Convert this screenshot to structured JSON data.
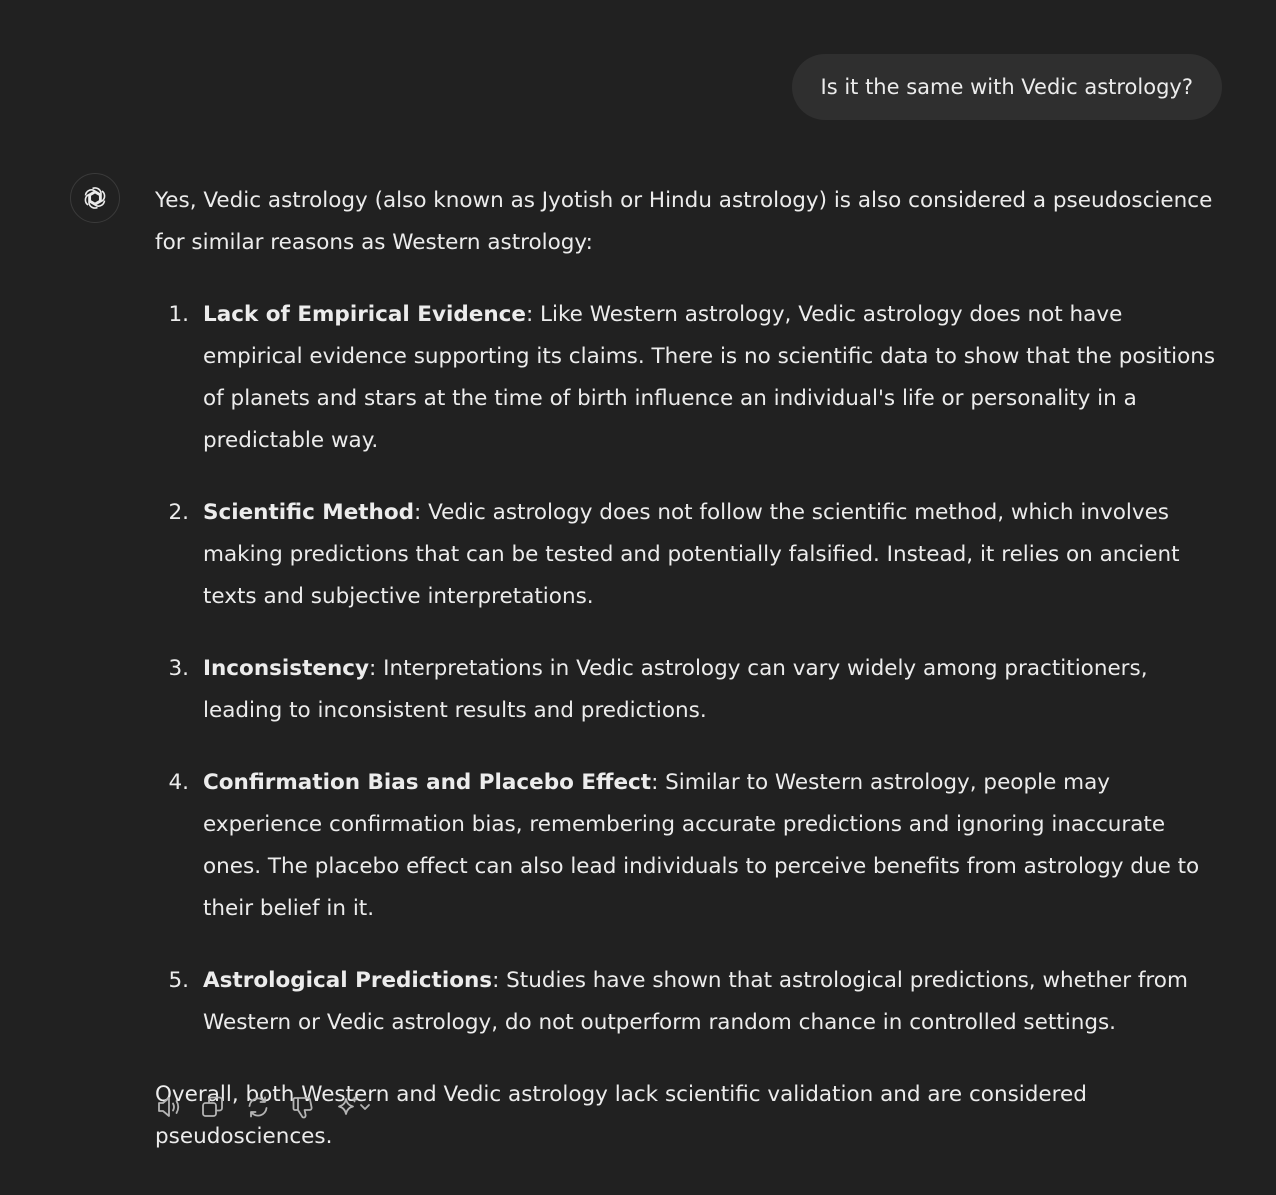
{
  "user_message": "Is it the same with Vedic astrology?",
  "assistant": {
    "avatar_icon": "openai-logo-icon",
    "intro": "Yes, Vedic astrology (also known as Jyotish or Hindu astrology) is also considered a pseudoscience for similar reasons as Western astrology:",
    "items": [
      {
        "number": "1.",
        "title": "Lack of Empirical Evidence",
        "text": ": Like Western astrology, Vedic astrology does not have empirical evidence supporting its claims. There is no scientific data to show that the positions of planets and stars at the time of birth influence an individual's life or personality in a predictable way."
      },
      {
        "number": "2.",
        "title": "Scientific Method",
        "text": ": Vedic astrology does not follow the scientific method, which involves making predictions that can be tested and potentially falsified. Instead, it relies on ancient texts and subjective interpretations."
      },
      {
        "number": "3.",
        "title": "Inconsistency",
        "text": ": Interpretations in Vedic astrology can vary widely among practitioners, leading to inconsistent results and predictions."
      },
      {
        "number": "4.",
        "title": "Confirmation Bias and Placebo Effect",
        "text": ": Similar to Western astrology, people may experience confirmation bias, remembering accurate predictions and ignoring inaccurate ones. The placebo effect can also lead individuals to perceive benefits from astrology due to their belief in it."
      },
      {
        "number": "5.",
        "title": "Astrological Predictions",
        "text": ": Studies have shown that astrological predictions, whether from Western or Vedic astrology, do not outperform random chance in controlled settings."
      }
    ],
    "conclusion": "Overall, both Western and Vedic astrology lack scientific validation and are considered pseudosciences."
  },
  "actions": [
    {
      "icon": "speaker-icon"
    },
    {
      "icon": "copy-icon"
    },
    {
      "icon": "regenerate-icon"
    },
    {
      "icon": "thumbs-down-icon"
    },
    {
      "icon": "sparkle-model-icon"
    }
  ],
  "colors": {
    "background": "#212121",
    "bubble": "#2f2f2f",
    "text": "#ececec",
    "icon": "#b4b4b4"
  }
}
